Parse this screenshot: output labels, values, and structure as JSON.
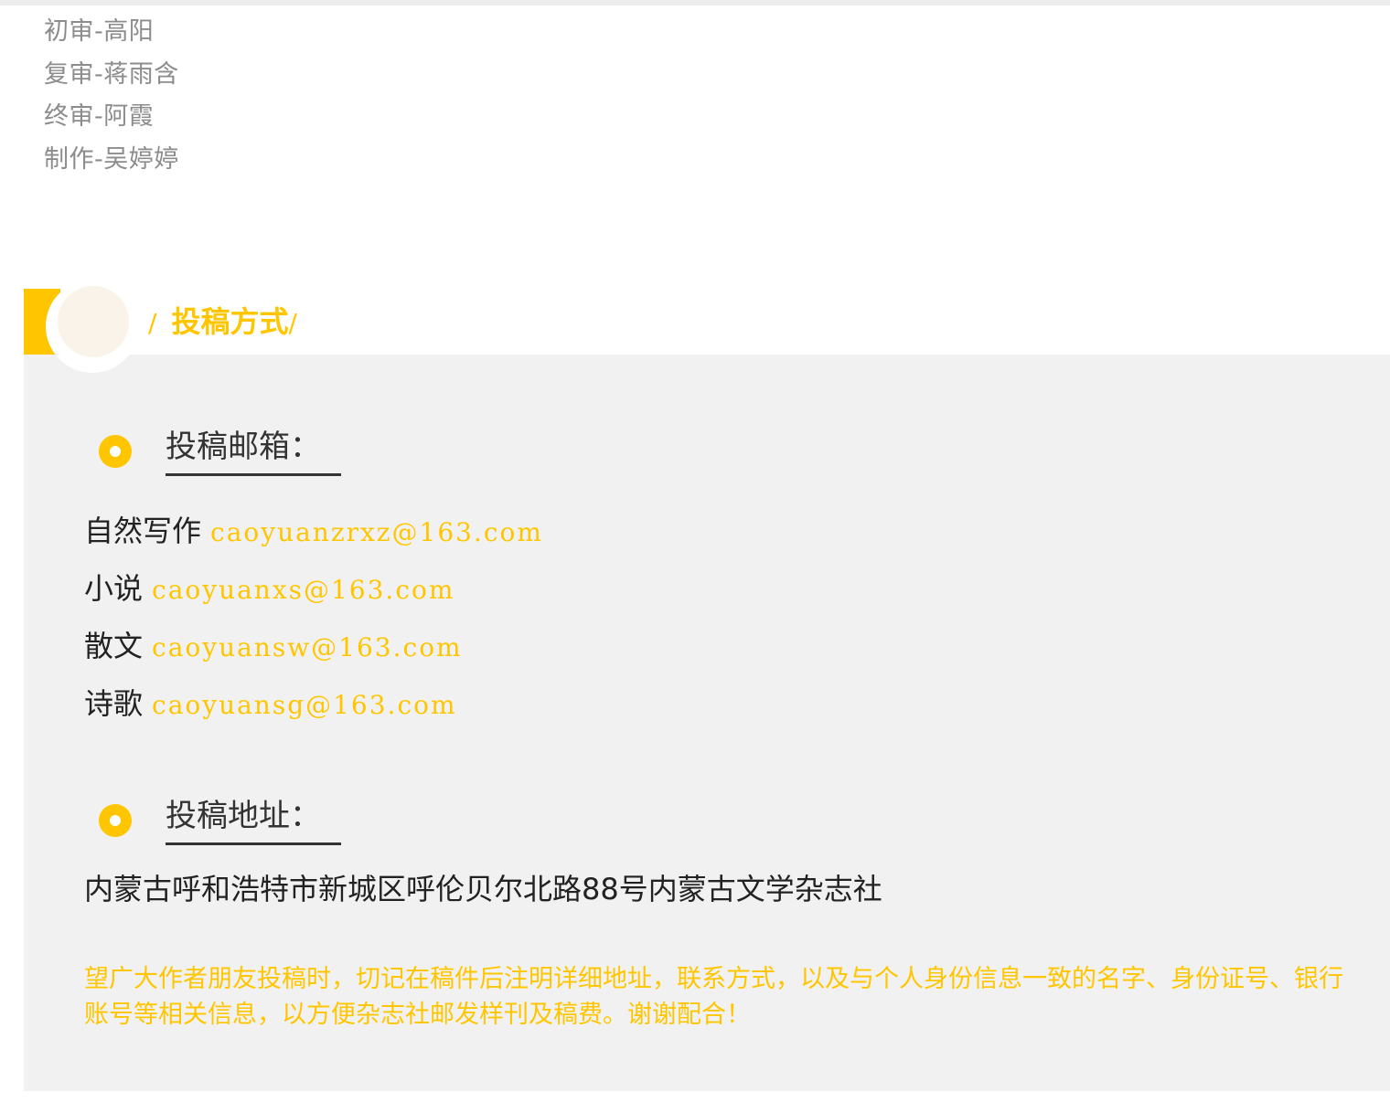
{
  "credits": [
    "初审-高阳",
    "复审-蒋雨含",
    "终审-阿霞",
    "制作-吴婷婷"
  ],
  "section": {
    "title": "投稿方式",
    "slash_left": "/",
    "slash_right": "/"
  },
  "email_heading": "投稿邮箱：",
  "emails": [
    {
      "category": "自然写作",
      "address": "caoyuanzrxz@163.com"
    },
    {
      "category": "小说",
      "address": "caoyuanxs@163.com"
    },
    {
      "category": "散文",
      "address": "caoyuansw@163.com"
    },
    {
      "category": "诗歌",
      "address": "caoyuansg@163.com"
    }
  ],
  "address_heading": "投稿地址：",
  "address": "内蒙古呼和浩特市新城区呼伦贝尔北路88号内蒙古文学杂志社",
  "notice": "望广大作者朋友投稿时，切记在稿件后注明详细地址，联系方式，以及与个人身份信息一致的名字、身份证号、银行账号等相关信息，以方便杂志社邮发样刊及稿费。谢谢配合！",
  "colors": {
    "accent": "#ffc600",
    "panel": "#f1f1f1",
    "credit_text": "#8c8c8c",
    "body_text": "#222222"
  },
  "icons": {
    "section_badge": "circle-badge-icon",
    "bullet": "ring-bullet-icon"
  }
}
